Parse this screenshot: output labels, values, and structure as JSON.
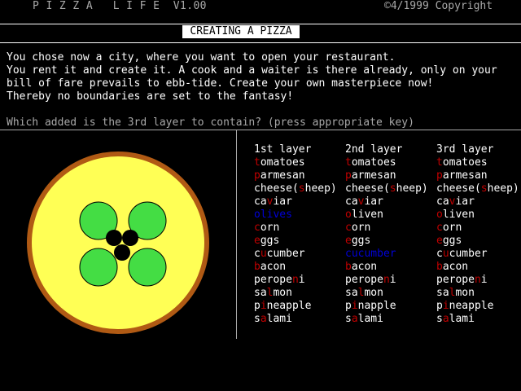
{
  "header": {
    "app_title": "P I Z Z A   L I F E  V1.00",
    "copyright": "©4/1999 Copyright",
    "screen_title": "CREATING A PIZZA"
  },
  "intro": {
    "line1": "You chose now a city, where you want to open your restaurant.",
    "line2": "You rent it and create it. A cook and a waiter is there already, only on your",
    "line3": "bill of fare prevails to ebb-tide. Create your own masterpiece now!",
    "line4": "Thereby no boundaries are set to the fantasy!"
  },
  "question": "Which added is the 3rd layer to contain? (press appropriate key)",
  "pizza": {
    "toppings": [
      "green circles",
      "black dots"
    ],
    "colors": {
      "cheese": "#ffff55",
      "crust": "#b05a14",
      "green": "#44dd44",
      "black": "#000000"
    }
  },
  "layers": [
    {
      "header": "1st layer",
      "options": [
        {
          "pre": "",
          "key": "t",
          "post": "omatoes",
          "selected": false
        },
        {
          "pre": "",
          "key": "p",
          "post": "armesan",
          "selected": false
        },
        {
          "pre": "cheese(",
          "key": "s",
          "post": "heep)",
          "selected": false
        },
        {
          "pre": "ca",
          "key": "v",
          "post": "iar",
          "selected": false
        },
        {
          "pre": "",
          "key": "o",
          "post": "lives",
          "selected": true
        },
        {
          "pre": "",
          "key": "c",
          "post": "orn",
          "selected": false
        },
        {
          "pre": "",
          "key": "e",
          "post": "ggs",
          "selected": false
        },
        {
          "pre": "c",
          "key": "u",
          "post": "cumber",
          "selected": false
        },
        {
          "pre": "",
          "key": "b",
          "post": "acon",
          "selected": false
        },
        {
          "pre": "perope",
          "key": "n",
          "post": "i",
          "selected": false
        },
        {
          "pre": "sa",
          "key": "l",
          "post": "mon",
          "selected": false
        },
        {
          "pre": "p",
          "key": "i",
          "post": "neapple",
          "selected": false
        },
        {
          "pre": "s",
          "key": "a",
          "post": "lami",
          "selected": false
        }
      ]
    },
    {
      "header": "2nd layer",
      "options": [
        {
          "pre": "",
          "key": "t",
          "post": "omatoes",
          "selected": false
        },
        {
          "pre": "",
          "key": "p",
          "post": "armesan",
          "selected": false
        },
        {
          "pre": "cheese(",
          "key": "s",
          "post": "heep)",
          "selected": false
        },
        {
          "pre": "ca",
          "key": "v",
          "post": "iar",
          "selected": false
        },
        {
          "pre": "",
          "key": "o",
          "post": "liven",
          "selected": false
        },
        {
          "pre": "",
          "key": "c",
          "post": "orn",
          "selected": false
        },
        {
          "pre": "",
          "key": "e",
          "post": "ggs",
          "selected": false
        },
        {
          "pre": "c",
          "key": "u",
          "post": "cumber",
          "selected": true
        },
        {
          "pre": "",
          "key": "b",
          "post": "acon",
          "selected": false
        },
        {
          "pre": "perope",
          "key": "n",
          "post": "i",
          "selected": false
        },
        {
          "pre": "sa",
          "key": "l",
          "post": "mon",
          "selected": false
        },
        {
          "pre": "p",
          "key": "i",
          "post": "napple",
          "selected": false
        },
        {
          "pre": "s",
          "key": "a",
          "post": "lami",
          "selected": false
        }
      ]
    },
    {
      "header": "3rd layer",
      "options": [
        {
          "pre": "",
          "key": "t",
          "post": "omatoes",
          "selected": false
        },
        {
          "pre": "",
          "key": "p",
          "post": "armesan",
          "selected": false
        },
        {
          "pre": "cheese(",
          "key": "s",
          "post": "heep)",
          "selected": false
        },
        {
          "pre": "ca",
          "key": "v",
          "post": "iar",
          "selected": false
        },
        {
          "pre": "",
          "key": "o",
          "post": "liven",
          "selected": false
        },
        {
          "pre": "",
          "key": "c",
          "post": "orn",
          "selected": false
        },
        {
          "pre": "",
          "key": "e",
          "post": "ggs",
          "selected": false
        },
        {
          "pre": "c",
          "key": "u",
          "post": "cumber",
          "selected": false
        },
        {
          "pre": "",
          "key": "b",
          "post": "acon",
          "selected": false
        },
        {
          "pre": "perope",
          "key": "n",
          "post": "i",
          "selected": false
        },
        {
          "pre": "sa",
          "key": "l",
          "post": "mon",
          "selected": false
        },
        {
          "pre": "p",
          "key": "i",
          "post": "neapple",
          "selected": false
        },
        {
          "pre": "s",
          "key": "a",
          "post": "lami",
          "selected": false
        }
      ]
    }
  ]
}
